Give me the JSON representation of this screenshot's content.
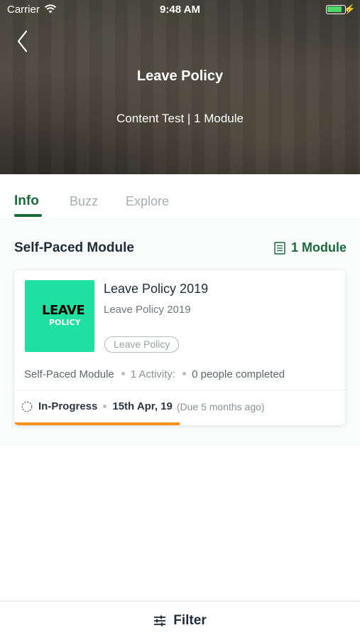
{
  "status_bar": {
    "carrier": "Carrier",
    "time": "9:48 AM"
  },
  "header": {
    "title": "Leave Policy",
    "subtitle": "Content Test | 1 Module"
  },
  "tabs": [
    {
      "label": "Info",
      "active": true
    },
    {
      "label": "Buzz",
      "active": false
    },
    {
      "label": "Explore",
      "active": false
    }
  ],
  "section": {
    "title": "Self-Paced Module",
    "module_count": "1 Module"
  },
  "card": {
    "thumbnail_line1": "LEAVE",
    "thumbnail_line2": "POLICY",
    "title": "Leave Policy 2019",
    "subtitle": "Leave Policy 2019",
    "tag": "Leave Policy",
    "type": "Self-Paced Module",
    "activities": "1 Activity:",
    "completed": "0 people completed",
    "status": "In-Progress",
    "due_date": "15th Apr, 19",
    "due_note": "(Due 5 months ago)",
    "progress": 0.5
  },
  "filter": {
    "label": "Filter"
  },
  "colors": {
    "accent_green": "#1b6b3a",
    "thumbnail_bg": "#1fe0a0",
    "progress_orange": "#f5921e"
  },
  "icons": [
    "back-chevron-icon",
    "wifi-icon",
    "battery-icon",
    "document-icon",
    "in-progress-icon",
    "filter-sliders-icon"
  ]
}
